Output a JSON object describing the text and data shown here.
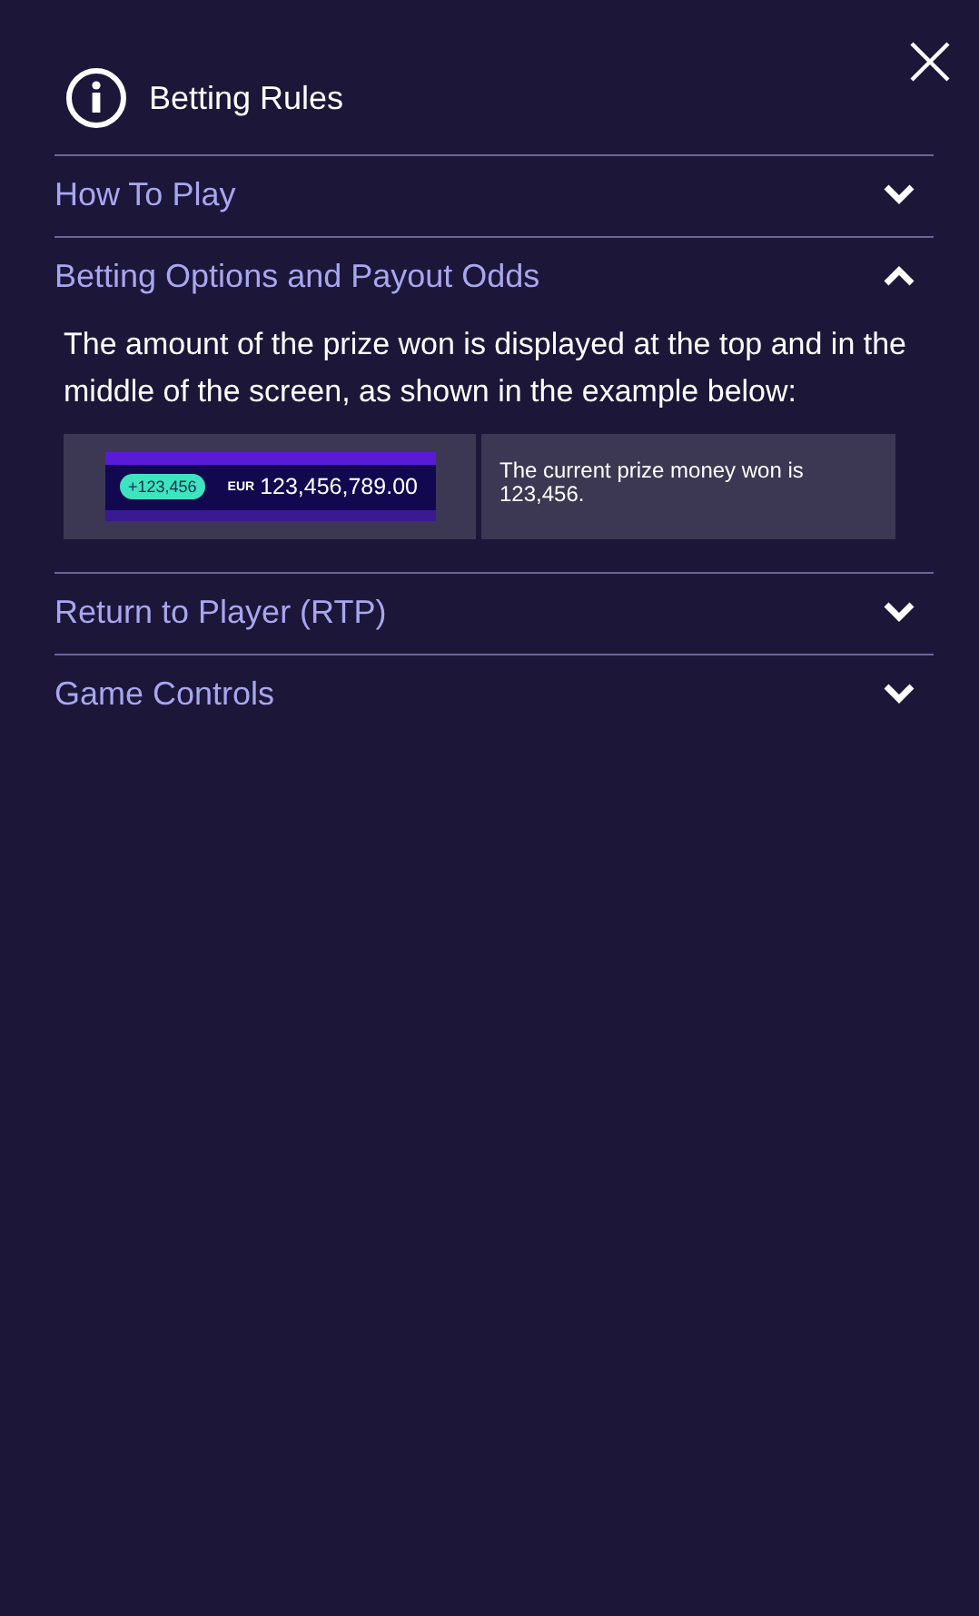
{
  "header": {
    "title": "Betting Rules"
  },
  "sections": [
    {
      "title": "How To Play",
      "expanded": false
    },
    {
      "title": "Betting Options and Payout Odds",
      "expanded": true,
      "intro": "The amount of the prize won is displayed at the top and in the middle of the screen, as shown in the example below:",
      "example": {
        "win_badge": "+123,456",
        "currency": "EUR",
        "amount": "123,456,789.00",
        "description": "The current prize money won is 123,456."
      }
    },
    {
      "title": "Return to Player (RTP)",
      "expanded": false
    },
    {
      "title": "Game Controls",
      "expanded": false
    }
  ]
}
